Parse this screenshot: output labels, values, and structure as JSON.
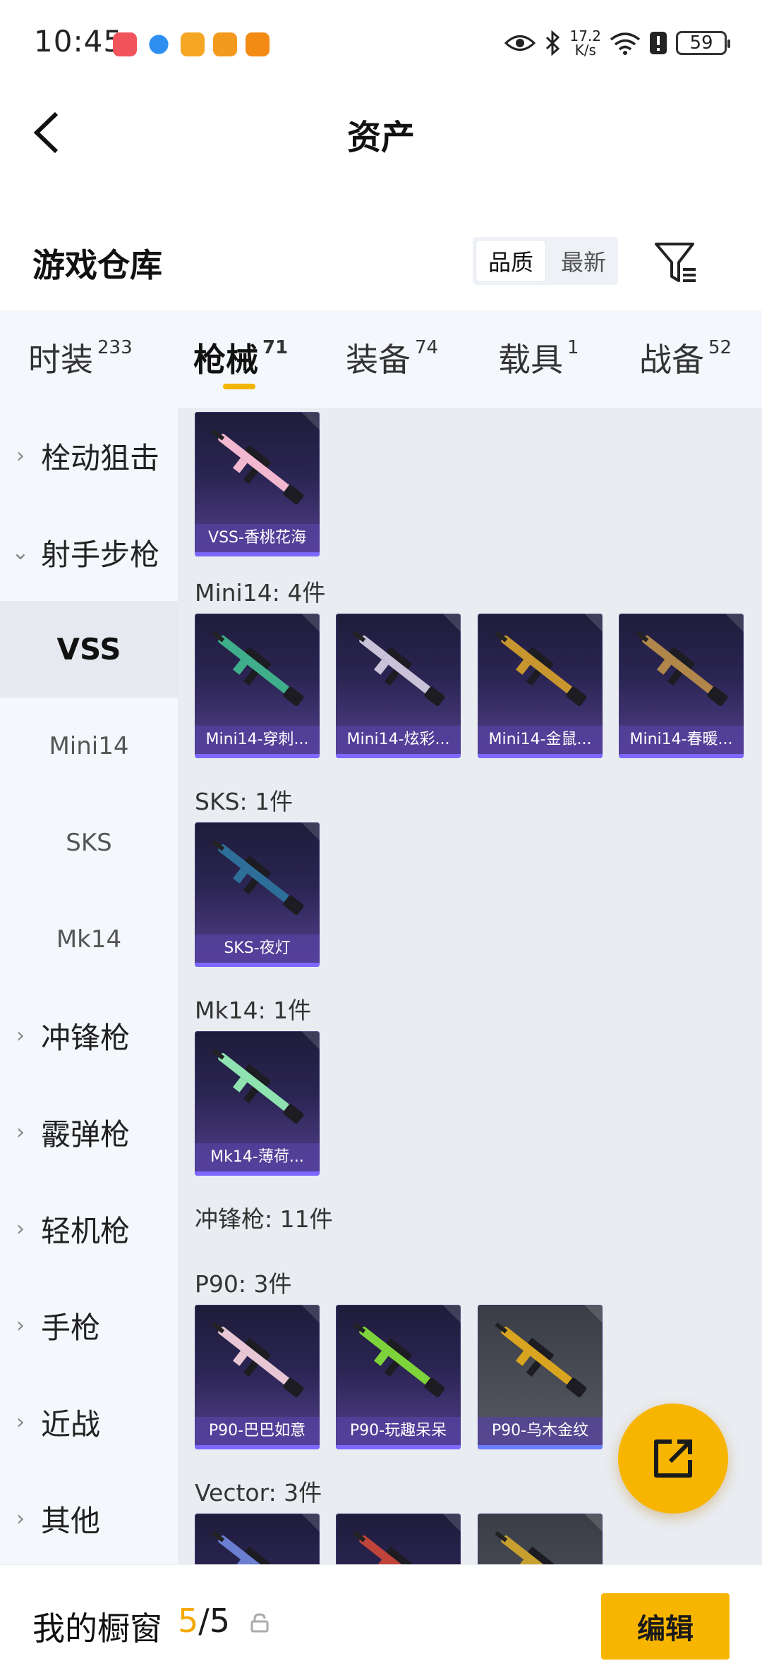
{
  "status_bar": {
    "time": "10:45",
    "net_speed_value": "17.2",
    "net_speed_unit": "K/s",
    "battery": "59"
  },
  "header": {
    "title": "资产"
  },
  "warehouse": {
    "title": "游戏仓库",
    "sort_options": [
      "品质",
      "最新"
    ],
    "sort_selected": "品质"
  },
  "tabs": [
    {
      "label": "时装",
      "count": "233"
    },
    {
      "label": "枪械",
      "count": "71"
    },
    {
      "label": "装备",
      "count": "74"
    },
    {
      "label": "载具",
      "count": "1"
    },
    {
      "label": "战备",
      "count": "52"
    }
  ],
  "active_tab": "枪械",
  "sidebar": {
    "items": [
      {
        "label": "栓动狙击",
        "expanded": false
      },
      {
        "label": "射手步枪",
        "expanded": true
      },
      {
        "label": "VSS",
        "sub": true,
        "active": true
      },
      {
        "label": "Mini14",
        "sub": true
      },
      {
        "label": "SKS",
        "sub": true
      },
      {
        "label": "Mk14",
        "sub": true
      },
      {
        "label": "冲锋枪",
        "expanded": false
      },
      {
        "label": "霰弹枪",
        "expanded": false
      },
      {
        "label": "轻机枪",
        "expanded": false
      },
      {
        "label": "手枪",
        "expanded": false
      },
      {
        "label": "近战",
        "expanded": false
      },
      {
        "label": "其他",
        "expanded": false
      }
    ]
  },
  "sections": [
    {
      "label": "",
      "items": [
        {
          "name": "VSS-香桃花海",
          "color": "#f2b8cf"
        }
      ]
    },
    {
      "label": "Mini14: 4件",
      "items": [
        {
          "name": "Mini14-穿刺...",
          "color": "#3fae8a"
        },
        {
          "name": "Mini14-炫彩...",
          "color": "#c9c2d8"
        },
        {
          "name": "Mini14-金鼠...",
          "color": "#c8962e"
        },
        {
          "name": "Mini14-春暖...",
          "color": "#b0864a"
        }
      ]
    },
    {
      "label": "SKS: 1件",
      "items": [
        {
          "name": "SKS-夜灯",
          "color": "#2e6f9a"
        }
      ]
    },
    {
      "label": "Mk14: 1件",
      "items": [
        {
          "name": "Mk14-薄荷...",
          "color": "#8fe3b0"
        }
      ]
    },
    {
      "label": "冲锋枪: 11件",
      "items": []
    },
    {
      "label": "P90: 3件",
      "items": [
        {
          "name": "P90-巴巴如意",
          "color": "#e8c6d4"
        },
        {
          "name": "P90-玩趣呆呆",
          "color": "#7ed33b"
        },
        {
          "name": "P90-乌木金纹",
          "color": "#d9a520",
          "grey": true
        }
      ]
    },
    {
      "label": "Vector: 3件",
      "items": [
        {
          "name": "",
          "color": "#6a7fd0"
        },
        {
          "name": "",
          "color": "#c0443a"
        },
        {
          "name": "",
          "color": "#c8a030",
          "grey": true
        }
      ]
    }
  ],
  "bottom_bar": {
    "showcase_label": "我的橱窗",
    "showcase_current": "5",
    "showcase_total": "/5",
    "edit_label": "编辑"
  }
}
